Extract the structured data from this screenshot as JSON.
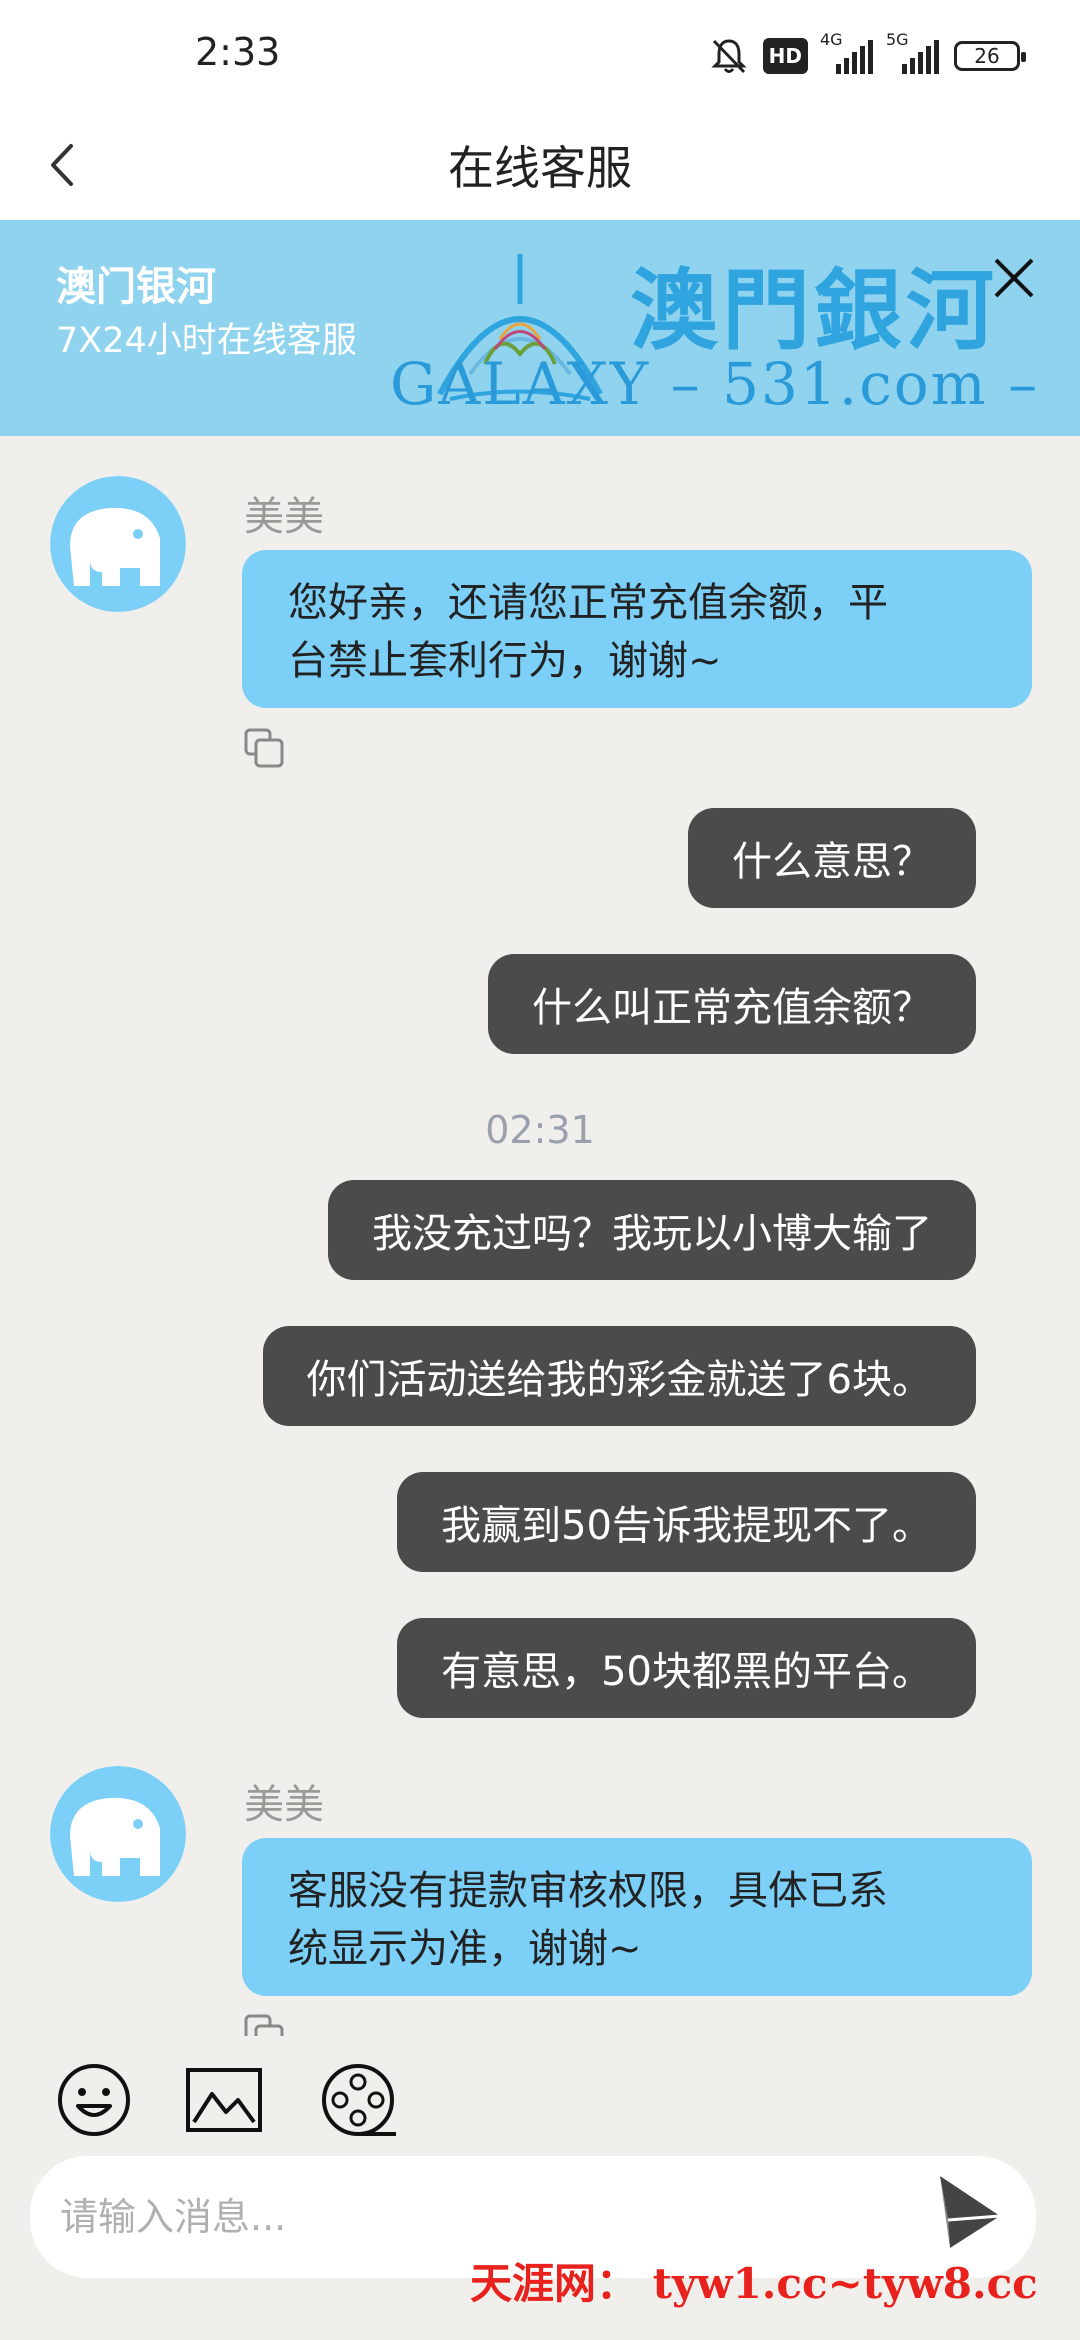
{
  "status_bar": {
    "time": "2:33",
    "hd_label": "HD",
    "net1_label": "4G",
    "net2_label": "5G",
    "battery": "26"
  },
  "header": {
    "title": "在线客服"
  },
  "banner": {
    "name": "澳门银河",
    "subtitle": "7X24小时在线客服",
    "brand": "澳門銀河",
    "site": "GALAXY – 531.com –"
  },
  "chat": {
    "messages": [
      {
        "from": "agent",
        "sender": "美美",
        "text_lines": [
          "您好亲，还请您正常充值余额，平",
          "台禁止套利行为，谢谢~"
        ]
      },
      {
        "from": "user",
        "text": "什么意思？"
      },
      {
        "from": "user",
        "text": "什么叫正常充值余额？"
      },
      {
        "divider": "02:31"
      },
      {
        "from": "user",
        "text": "我没充过吗？我玩以小博大输了"
      },
      {
        "from": "user",
        "text": "你们活动送给我的彩金就送了6块。"
      },
      {
        "from": "user",
        "text": "我赢到50告诉我提现不了。"
      },
      {
        "from": "user",
        "text": "有意思，50块都黑的平台。"
      },
      {
        "from": "agent",
        "sender": "美美",
        "text_lines": [
          "客服没有提款审核权限，具体已系",
          "统显示为准，谢谢~"
        ]
      }
    ]
  },
  "input": {
    "placeholder": "请输入消息..."
  },
  "watermark": "天涯网： tyw1.cc~tyw8.cc",
  "colors": {
    "agent_bubble": "#7cd0f8",
    "user_bubble": "#4b4b4b",
    "banner_bg": "#8fd3ee",
    "chat_bg": "#f0efeb",
    "watermark": "#e8211d"
  },
  "icons": [
    "back-icon",
    "close-icon",
    "elephant-avatar-icon",
    "copy-icon",
    "emoji-icon",
    "image-icon",
    "video-icon",
    "send-icon",
    "mute-bell-icon",
    "signal-icon",
    "battery-icon"
  ]
}
